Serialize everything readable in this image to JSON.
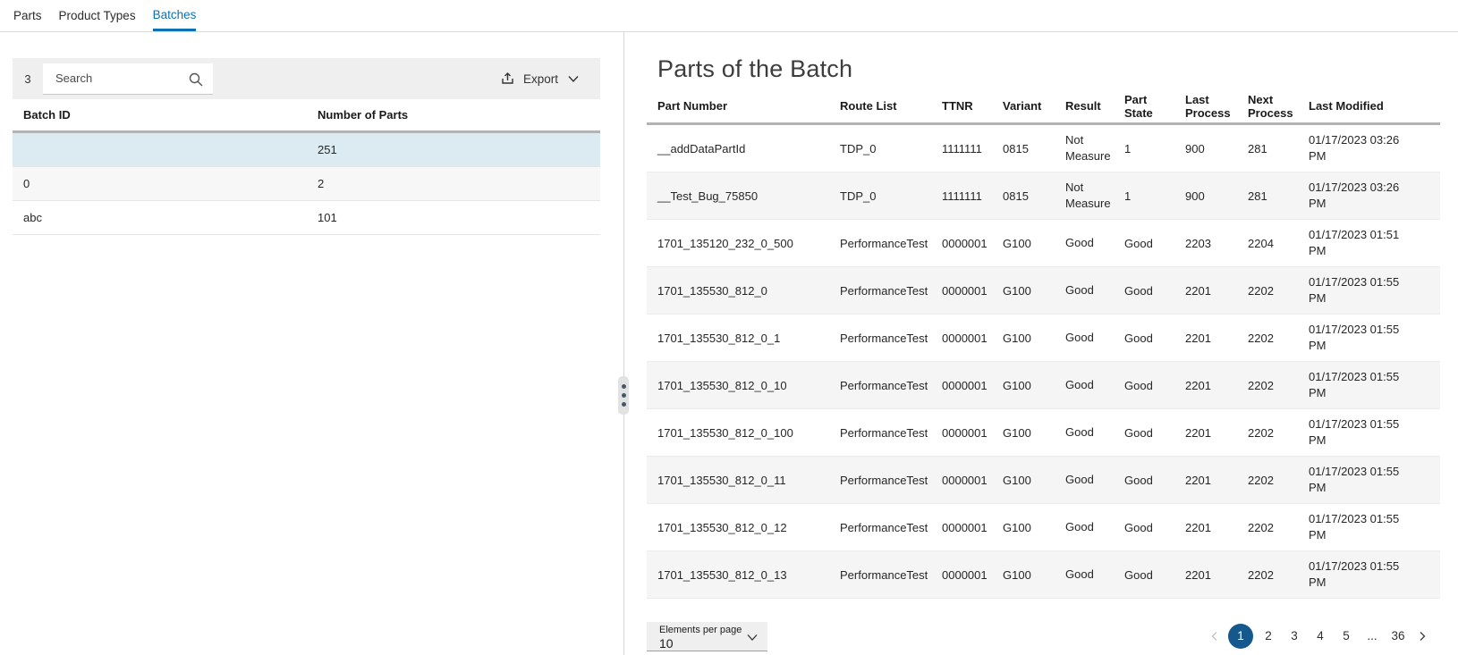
{
  "tabs": [
    {
      "label": "Parts",
      "active": false
    },
    {
      "label": "Product Types",
      "active": false
    },
    {
      "label": "Batches",
      "active": true
    }
  ],
  "batch_panel": {
    "count": "3",
    "search_placeholder": "Search",
    "export_label": "Export",
    "columns": [
      "Batch ID",
      "Number of Parts"
    ],
    "rows": [
      {
        "batch_id": "",
        "number_of_parts": "251",
        "selected": true
      },
      {
        "batch_id": "0",
        "number_of_parts": "2",
        "selected": false
      },
      {
        "batch_id": "abc",
        "number_of_parts": "101",
        "selected": false
      }
    ]
  },
  "parts_panel": {
    "title": "Parts of the Batch",
    "columns": [
      "Part Number",
      "Route List",
      "TTNR",
      "Variant",
      "Result",
      "Part State",
      "Last Process",
      "Next Process",
      "Last Modified"
    ],
    "rows": [
      [
        "__addDataPartId",
        "TDP_0",
        "1111111",
        "0815",
        "Not Measured",
        "1",
        "900",
        "281",
        "01/17/2023 03:26 PM"
      ],
      [
        "__Test_Bug_75850",
        "TDP_0",
        "1111111",
        "0815",
        "Not Measured",
        "1",
        "900",
        "281",
        "01/17/2023 03:26 PM"
      ],
      [
        "1701_135120_232_0_500",
        "PerformanceTest",
        "0000001",
        "G100",
        "Good",
        "Good",
        "2203",
        "2204",
        "01/17/2023 01:51 PM"
      ],
      [
        "1701_135530_812_0",
        "PerformanceTest",
        "0000001",
        "G100",
        "Good",
        "Good",
        "2201",
        "2202",
        "01/17/2023 01:55 PM"
      ],
      [
        "1701_135530_812_0_1",
        "PerformanceTest",
        "0000001",
        "G100",
        "Good",
        "Good",
        "2201",
        "2202",
        "01/17/2023 01:55 PM"
      ],
      [
        "1701_135530_812_0_10",
        "PerformanceTest",
        "0000001",
        "G100",
        "Good",
        "Good",
        "2201",
        "2202",
        "01/17/2023 01:55 PM"
      ],
      [
        "1701_135530_812_0_100",
        "PerformanceTest",
        "0000001",
        "G100",
        "Good",
        "Good",
        "2201",
        "2202",
        "01/17/2023 01:55 PM"
      ],
      [
        "1701_135530_812_0_11",
        "PerformanceTest",
        "0000001",
        "G100",
        "Good",
        "Good",
        "2201",
        "2202",
        "01/17/2023 01:55 PM"
      ],
      [
        "1701_135530_812_0_12",
        "PerformanceTest",
        "0000001",
        "G100",
        "Good",
        "Good",
        "2201",
        "2202",
        "01/17/2023 01:55 PM"
      ],
      [
        "1701_135530_812_0_13",
        "PerformanceTest",
        "0000001",
        "G100",
        "Good",
        "Good",
        "2201",
        "2202",
        "01/17/2023 01:55 PM"
      ]
    ],
    "pagination": {
      "elements_per_page_label": "Elements per page",
      "elements_per_page_value": "10",
      "pages": [
        "1",
        "2",
        "3",
        "4",
        "5",
        "...",
        "36"
      ],
      "active_page": "1"
    }
  },
  "icons": {
    "search": "magnifier",
    "export": "upload-tray",
    "export_menu": "chevron-down",
    "elements_per_page": "chevron-down",
    "prev_page": "chevron-left",
    "next_page": "chevron-right",
    "splitter": "drag-handle-dots"
  },
  "colors": {
    "accent_blue": "#0d72b2",
    "selected_row": "#dcebf2",
    "active_page": "#14588d",
    "toolbar_gray": "#efefef",
    "stripe_gray": "#f5f5f5"
  }
}
